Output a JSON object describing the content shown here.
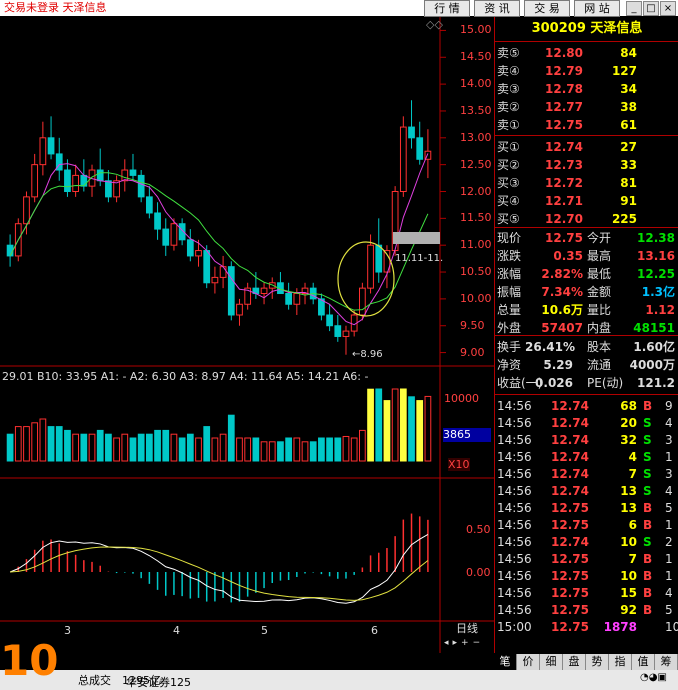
{
  "topbar": {
    "title": "交易未登录  天泽信息",
    "buttons": [
      "行 情",
      "资 讯",
      "交 易",
      "网 站"
    ]
  },
  "quote": {
    "header": "300209 天泽信息",
    "sell": [
      {
        "label": "卖⑤",
        "price": "12.80",
        "vol": "84"
      },
      {
        "label": "卖④",
        "price": "12.79",
        "vol": "127"
      },
      {
        "label": "卖③",
        "price": "12.78",
        "vol": "34"
      },
      {
        "label": "卖②",
        "price": "12.77",
        "vol": "38"
      },
      {
        "label": "卖①",
        "price": "12.75",
        "vol": "61"
      }
    ],
    "buy": [
      {
        "label": "买①",
        "price": "12.74",
        "vol": "27"
      },
      {
        "label": "买②",
        "price": "12.73",
        "vol": "33"
      },
      {
        "label": "买③",
        "price": "12.72",
        "vol": "81"
      },
      {
        "label": "买④",
        "price": "12.71",
        "vol": "91"
      },
      {
        "label": "买⑤",
        "price": "12.70",
        "vol": "225"
      }
    ],
    "stats1": [
      {
        "k1": "现价",
        "v1": "12.75",
        "k2": "今开",
        "v2": "12.38"
      },
      {
        "k1": "涨跌",
        "v1": "0.35",
        "k2": "最高",
        "v2": "13.16"
      },
      {
        "k1": "涨幅",
        "v1": "2.82%",
        "k2": "最低",
        "v2": "12.25"
      },
      {
        "k1": "振幅",
        "v1": "7.34%",
        "k2": "金额",
        "v2": "1.3亿"
      },
      {
        "k1": "总量",
        "v1": "10.6万",
        "k2": "量比",
        "v2": "1.12"
      },
      {
        "k1": "外盘",
        "v1": "57407",
        "k2": "内盘",
        "v2": "48151"
      }
    ],
    "stats2": [
      {
        "k1": "换手",
        "v1": "26.41%",
        "k2": "股本",
        "v2": "1.60亿"
      },
      {
        "k1": "净资",
        "v1": "5.29",
        "k2": "流通",
        "v2": "4000万"
      },
      {
        "k1": "收益(一)",
        "v1": "0.026",
        "k2": "PE(动)",
        "v2": "121.2"
      }
    ],
    "ticks": [
      {
        "t": "14:56",
        "p": "12.74",
        "v": "68",
        "f": "B",
        "n": "9"
      },
      {
        "t": "14:56",
        "p": "12.74",
        "v": "20",
        "f": "S",
        "n": "4"
      },
      {
        "t": "14:56",
        "p": "12.74",
        "v": "32",
        "f": "S",
        "n": "3"
      },
      {
        "t": "14:56",
        "p": "12.74",
        "v": "4",
        "f": "S",
        "n": "1"
      },
      {
        "t": "14:56",
        "p": "12.74",
        "v": "7",
        "f": "S",
        "n": "3"
      },
      {
        "t": "14:56",
        "p": "12.74",
        "v": "13",
        "f": "S",
        "n": "4"
      },
      {
        "t": "14:56",
        "p": "12.75",
        "v": "13",
        "f": "B",
        "n": "5"
      },
      {
        "t": "14:56",
        "p": "12.75",
        "v": "6",
        "f": "B",
        "n": "1"
      },
      {
        "t": "14:56",
        "p": "12.74",
        "v": "10",
        "f": "S",
        "n": "2"
      },
      {
        "t": "14:56",
        "p": "12.75",
        "v": "7",
        "f": "B",
        "n": "1"
      },
      {
        "t": "14:56",
        "p": "12.75",
        "v": "10",
        "f": "B",
        "n": "1"
      },
      {
        "t": "14:56",
        "p": "12.75",
        "v": "15",
        "f": "B",
        "n": "4"
      },
      {
        "t": "14:56",
        "p": "12.75",
        "v": "92",
        "f": "B",
        "n": "5"
      },
      {
        "t": "15:00",
        "p": "12.75",
        "v": "1878",
        "f": "",
        "n": "105"
      }
    ]
  },
  "tabs": [
    "笔",
    "价",
    "细",
    "盘",
    "势",
    "指",
    "值",
    "筹"
  ],
  "chart": {
    "price_axis": [
      "15.00",
      "14.50",
      "14.00",
      "13.50",
      "13.00",
      "12.50",
      "12.00",
      "11.50",
      "11.00",
      "10.50",
      "10.00",
      "9.50",
      "9.00"
    ],
    "price_range": [
      8.75,
      15.25
    ],
    "low_marker": "8.96",
    "range_marker": "11.11-11.",
    "ma_line": "29.01  B10: 33.95  A1: -  A2: 6.30  A3: 8.97  A4: 11.64  A5: 14.21  A6: -",
    "vol_axis": [
      "10000",
      "5000"
    ],
    "vol_tag": "3865",
    "vol_unit": "X10",
    "macd_axis": [
      "0.50",
      "0.00"
    ],
    "months": [
      "3",
      "4",
      "5",
      "6"
    ],
    "period": "日线",
    "colors": {
      "up": "#ff3030",
      "down": "#00c8c8",
      "ma5": "#e040e0",
      "ma10": "#40e040",
      "ma20": "#ffffff",
      "circle": "#e0e040"
    }
  },
  "status": {
    "left": "总成交",
    "left_val": "1295亿",
    "broker": "华安证券125"
  },
  "chart_data": {
    "type": "candlestick",
    "note_series": "daily candles",
    "ohlc": [
      [
        11.0,
        11.2,
        10.6,
        10.8
      ],
      [
        10.8,
        11.5,
        10.7,
        11.4
      ],
      [
        11.4,
        12.0,
        11.2,
        11.9
      ],
      [
        11.9,
        12.7,
        11.8,
        12.5
      ],
      [
        12.5,
        13.3,
        12.3,
        13.0
      ],
      [
        13.0,
        13.4,
        12.6,
        12.7
      ],
      [
        12.7,
        13.0,
        12.2,
        12.4
      ],
      [
        12.4,
        12.6,
        11.9,
        12.0
      ],
      [
        12.0,
        12.5,
        11.9,
        12.3
      ],
      [
        12.3,
        12.6,
        12.0,
        12.1
      ],
      [
        12.1,
        12.5,
        11.9,
        12.4
      ],
      [
        12.4,
        12.8,
        12.1,
        12.2
      ],
      [
        12.2,
        12.4,
        11.8,
        11.9
      ],
      [
        11.9,
        12.3,
        11.8,
        12.2
      ],
      [
        12.2,
        12.6,
        12.0,
        12.4
      ],
      [
        12.4,
        12.7,
        12.2,
        12.3
      ],
      [
        12.3,
        12.4,
        11.8,
        11.9
      ],
      [
        11.9,
        12.1,
        11.5,
        11.6
      ],
      [
        11.6,
        11.8,
        11.1,
        11.3
      ],
      [
        11.3,
        11.5,
        10.8,
        11.0
      ],
      [
        11.0,
        11.5,
        10.9,
        11.4
      ],
      [
        11.4,
        11.5,
        11.0,
        11.1
      ],
      [
        11.1,
        11.3,
        10.7,
        10.8
      ],
      [
        10.8,
        11.1,
        10.6,
        10.9
      ],
      [
        10.9,
        11.0,
        10.2,
        10.3
      ],
      [
        10.3,
        10.6,
        10.1,
        10.4
      ],
      [
        10.4,
        10.8,
        10.2,
        10.6
      ],
      [
        10.6,
        10.7,
        9.6,
        9.7
      ],
      [
        9.7,
        10.0,
        9.5,
        9.9
      ],
      [
        9.9,
        10.3,
        9.8,
        10.2
      ],
      [
        10.2,
        10.5,
        10.0,
        10.1
      ],
      [
        10.1,
        10.3,
        9.9,
        10.2
      ],
      [
        10.2,
        10.4,
        10.0,
        10.3
      ],
      [
        10.3,
        10.5,
        10.1,
        10.1
      ],
      [
        10.1,
        10.3,
        9.8,
        9.9
      ],
      [
        9.9,
        10.2,
        9.7,
        10.1
      ],
      [
        10.1,
        10.3,
        9.9,
        10.2
      ],
      [
        10.2,
        10.3,
        9.9,
        10.0
      ],
      [
        10.0,
        10.1,
        9.6,
        9.7
      ],
      [
        9.7,
        9.9,
        9.4,
        9.5
      ],
      [
        9.5,
        9.7,
        9.2,
        9.3
      ],
      [
        9.3,
        9.5,
        8.96,
        9.4
      ],
      [
        9.4,
        9.8,
        9.3,
        9.7
      ],
      [
        9.7,
        10.3,
        9.6,
        10.2
      ],
      [
        10.2,
        11.2,
        10.1,
        11.0
      ],
      [
        11.0,
        11.5,
        10.3,
        10.5
      ],
      [
        10.5,
        11.0,
        10.2,
        10.9
      ],
      [
        10.9,
        12.1,
        10.8,
        12.0
      ],
      [
        12.0,
        13.4,
        11.9,
        13.2
      ],
      [
        13.2,
        13.7,
        12.8,
        13.0
      ],
      [
        13.0,
        13.3,
        12.5,
        12.6
      ],
      [
        12.6,
        13.16,
        12.25,
        12.75
      ]
    ]
  }
}
